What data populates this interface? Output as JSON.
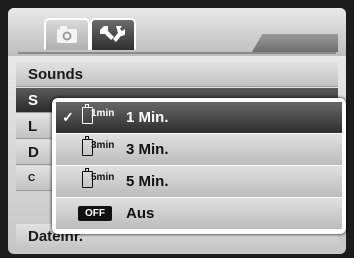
{
  "tabs": [
    {
      "icon": "camera-icon"
    },
    {
      "icon": "setup-tools-icon"
    }
  ],
  "menu": {
    "items": [
      {
        "label": "Sounds"
      },
      {
        "label": "S"
      },
      {
        "label": "L"
      },
      {
        "label": "D"
      },
      {
        "label": "C"
      },
      {
        "label": "Dateinr."
      }
    ]
  },
  "popup": {
    "options": [
      {
        "icon": "battery-1min-icon",
        "sub": "1min",
        "label": "1 Min.",
        "checkmark": "✓"
      },
      {
        "icon": "battery-3min-icon",
        "sub": "3min",
        "label": "3 Min."
      },
      {
        "icon": "battery-5min-icon",
        "sub": "5min",
        "label": "5 Min."
      },
      {
        "icon": "off-icon",
        "badge": "OFF",
        "label": "Aus"
      }
    ]
  }
}
